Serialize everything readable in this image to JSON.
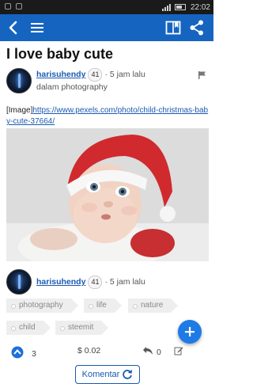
{
  "status_bar": {
    "time": "22:02"
  },
  "post": {
    "title": "I love baby cute",
    "author": {
      "name": "harisuhendy",
      "reputation": "41",
      "time_ago": "5 jam lalu"
    },
    "category": "dalam photography",
    "body": {
      "prefix": "[Image]",
      "link": "https://www.pexels.com/photo/child-christmas-baby-cute-37664/"
    },
    "footer_author": {
      "name": "harisuhendy",
      "reputation": "41",
      "time_ago": "5 jam lalu"
    },
    "tags": [
      "photography",
      "life",
      "nature",
      "child",
      "steemit"
    ],
    "votes": "3",
    "payout": "$ 0.02",
    "reblogs": "0",
    "comment_button": "Komentar"
  },
  "colors": {
    "primary": "#1565c0",
    "link": "#1a5ab0",
    "fab": "#1e7be6"
  },
  "icons": {
    "back": "chevron-left-icon",
    "menu": "hamburger-menu-icon",
    "book": "book-icon",
    "share": "share-icon",
    "flag": "flag-icon",
    "fab": "plus-icon",
    "upvote": "upvote-icon",
    "reply": "reply-icon",
    "edit": "edit-icon"
  }
}
